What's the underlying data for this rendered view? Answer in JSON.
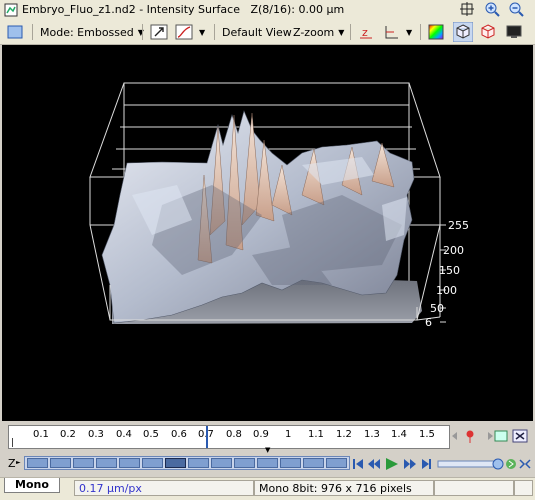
{
  "window": {
    "title": "Embryo_Fluo_z1.nd2 - Intensity Surface",
    "z_info": "Z(8/16): 0.00 µm"
  },
  "toolbar": {
    "mode_label": "Mode: Embossed",
    "default_view_label": "Default View",
    "zzoom_label": "Z-zoom"
  },
  "scale": {
    "labels": [
      "255",
      "200",
      "150",
      "100",
      "50",
      "6"
    ]
  },
  "ruler": {
    "ticks": [
      "0.1",
      "0.2",
      "0.3",
      "0.4",
      "0.5",
      "0.6",
      "0.7",
      "0.8",
      "0.9",
      "1",
      "1.1",
      "1.2",
      "1.3",
      "1.4",
      "1.5"
    ]
  },
  "zrow": {
    "label": "Z",
    "current_index": 8,
    "count": 16
  },
  "status": {
    "tab_label": "Mono",
    "scale": "0.17 µm/px",
    "image_info": "Mono 8bit: 976 x 716 pixels"
  },
  "colors": {
    "scale_text": "#3333cc",
    "viewport_bg": "#000000",
    "z_accent": "#4a6aa0"
  }
}
